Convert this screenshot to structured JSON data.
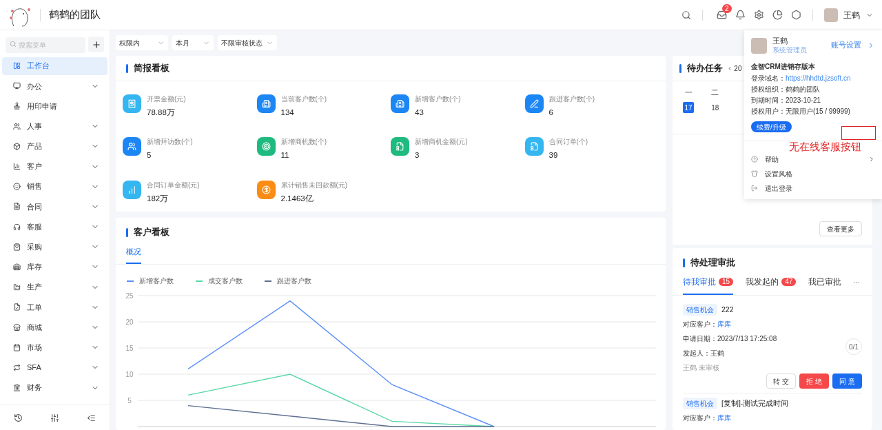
{
  "header": {
    "team_name": "鹤鹤的团队",
    "inbox_badge": "2",
    "user_name": "王鹤"
  },
  "sidebar": {
    "search": {
      "placeholder": "搜索菜单"
    },
    "items": [
      {
        "label": "工作台",
        "selected": true,
        "has_submenu": false
      },
      {
        "label": "办公",
        "selected": false,
        "has_submenu": true
      },
      {
        "label": "用印申请",
        "selected": false,
        "has_submenu": false
      },
      {
        "label": "人事",
        "selected": false,
        "has_submenu": true
      },
      {
        "label": "产品",
        "selected": false,
        "has_submenu": true
      },
      {
        "label": "客户",
        "selected": false,
        "has_submenu": true
      },
      {
        "label": "销售",
        "selected": false,
        "has_submenu": true
      },
      {
        "label": "合同",
        "selected": false,
        "has_submenu": true
      },
      {
        "label": "客服",
        "selected": false,
        "has_submenu": true
      },
      {
        "label": "采购",
        "selected": false,
        "has_submenu": true
      },
      {
        "label": "库存",
        "selected": false,
        "has_submenu": true
      },
      {
        "label": "生产",
        "selected": false,
        "has_submenu": true
      },
      {
        "label": "工单",
        "selected": false,
        "has_submenu": true
      },
      {
        "label": "商城",
        "selected": false,
        "has_submenu": true
      },
      {
        "label": "市场",
        "selected": false,
        "has_submenu": true
      },
      {
        "label": "SFA",
        "selected": false,
        "has_submenu": true
      },
      {
        "label": "财务",
        "selected": false,
        "has_submenu": true
      }
    ]
  },
  "filters": [
    "权限内",
    "本月",
    "不限审核状态"
  ],
  "brief_board": {
    "title": "简报看板",
    "stats": [
      {
        "label": "开票金额(元)",
        "value": "78.88万",
        "color": "#35b6f0"
      },
      {
        "label": "当前客户数(个)",
        "value": "134",
        "color": "#1c86f5"
      },
      {
        "label": "新增客户数(个)",
        "value": "43",
        "color": "#1c86f5"
      },
      {
        "label": "跟进客户数(个)",
        "value": "6",
        "color": "#1c86f5"
      },
      {
        "label": "新增拜访数(个)",
        "value": "5",
        "color": "#1c86f5"
      },
      {
        "label": "新增商机数(个)",
        "value": "11",
        "color": "#1fba7f"
      },
      {
        "label": "新增商机金额(元)",
        "value": "3",
        "color": "#1fba7f"
      },
      {
        "label": "合同订单(个)",
        "value": "39",
        "color": "#35b6f0"
      },
      {
        "label": "合同订单金额(元)",
        "value": "182万",
        "color": "#35b6f0"
      },
      {
        "label": "累计销售未回款额(元)",
        "value": "2.1463亿",
        "color": "#fa8c16"
      }
    ]
  },
  "customer_board": {
    "title": "客户看板",
    "tabs": [
      {
        "label": "概况",
        "selected": true
      }
    ],
    "chart_data": {
      "type": "line",
      "ylim": [
        0,
        25
      ],
      "yticks": [
        5,
        10,
        15,
        20,
        25
      ],
      "grid": true,
      "legend": true,
      "series": [
        {
          "name": "新增客户数",
          "color": "#5b8ff9",
          "values": [
            11,
            24,
            8,
            0
          ]
        },
        {
          "name": "成交客户数",
          "color": "#5ad8a6",
          "values": [
            6,
            10,
            1,
            0
          ]
        },
        {
          "name": "跟进客户数",
          "color": "#5d7092",
          "values": [
            4,
            2,
            0,
            0
          ]
        }
      ]
    }
  },
  "todo": {
    "title": "待办任务",
    "prev": "‹",
    "year": "20",
    "weekdays": [
      "一",
      "二"
    ],
    "dates": [
      {
        "label": "17",
        "selected": true
      },
      {
        "label": "18",
        "selected": false
      }
    ],
    "more_button": "查看更多"
  },
  "approvals": {
    "title": "待处理审批",
    "tabs": [
      {
        "label": "待我审批",
        "badge": "15",
        "selected": true
      },
      {
        "label": "我发起的",
        "badge": "47",
        "selected": false
      },
      {
        "label": "我已审批",
        "selected": false
      }
    ],
    "more": "···",
    "items": [
      {
        "tag": "销售机会",
        "title": "222",
        "customer_label": "对应客户：",
        "customer": "库库",
        "date": "申请日期：2023/7/13 17:25:08",
        "initiator": "发起人：王鹤",
        "status": "王鹤 未审核",
        "progress": "0/1",
        "buttons": [
          {
            "label": "转 交",
            "kind": "default"
          },
          {
            "label": "拒 绝",
            "kind": "danger"
          },
          {
            "label": "同 意",
            "kind": "primary"
          }
        ]
      },
      {
        "tag": "销售机会",
        "title": "[复制]-测试完成时间",
        "customer_label": "对应客户：",
        "customer": "库库"
      }
    ]
  },
  "user_panel": {
    "name": "王鹤",
    "role": "系统管理员",
    "account_settings": "账号设置",
    "product": "金智CRM进销存版本",
    "fields": [
      {
        "label": "登录域名：",
        "value": "https://hhdtd.jzsoft.cn",
        "kind": "link"
      },
      {
        "label": "授权组织：",
        "value": "鹤鹤的团队",
        "kind": "text"
      },
      {
        "label": "到期时间：",
        "value": "2023-10-21",
        "kind": "text"
      },
      {
        "label": "授权用户：",
        "value": "无限用户(15 / 99999)",
        "kind": "text"
      }
    ],
    "renew_button": "续费/升级",
    "annotation": "无在线客服按钮",
    "menu": [
      {
        "label": "帮助",
        "has_submenu": true
      },
      {
        "label": "设置风格",
        "has_submenu": false
      },
      {
        "label": "退出登录",
        "has_submenu": false
      }
    ]
  }
}
